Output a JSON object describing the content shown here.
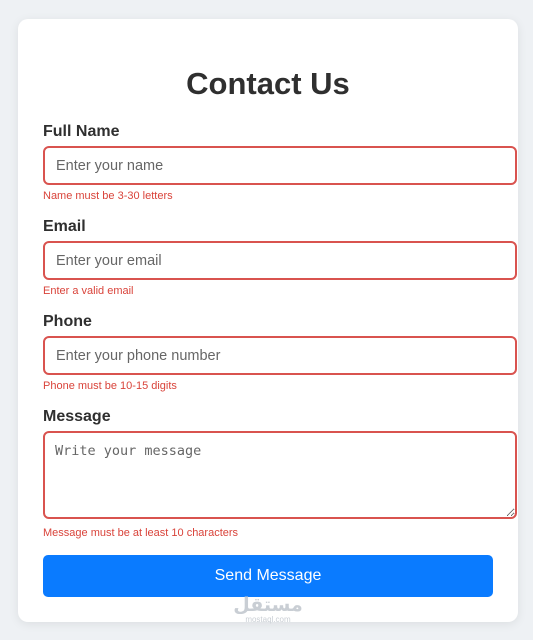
{
  "form": {
    "title": "Contact Us",
    "fields": {
      "name": {
        "label": "Full Name",
        "placeholder": "Enter your name",
        "value": "",
        "error": "Name must be 3-30 letters"
      },
      "email": {
        "label": "Email",
        "placeholder": "Enter your email",
        "value": "",
        "error": "Enter a valid email"
      },
      "phone": {
        "label": "Phone",
        "placeholder": "Enter your phone number",
        "value": "",
        "error": "Phone must be 10-15 digits"
      },
      "message": {
        "label": "Message",
        "placeholder": "Write your message",
        "value": "",
        "error": "Message must be at least 10 characters"
      }
    },
    "submit_label": "Send Message"
  },
  "watermark": {
    "text": "مستقل",
    "subtext": "mostaql.com"
  },
  "colors": {
    "accent": "#0a7bff",
    "error": "#d9433a",
    "error_border": "#d9534f",
    "background": "#eef1f4",
    "card": "#ffffff",
    "text": "#2f2f2f"
  }
}
